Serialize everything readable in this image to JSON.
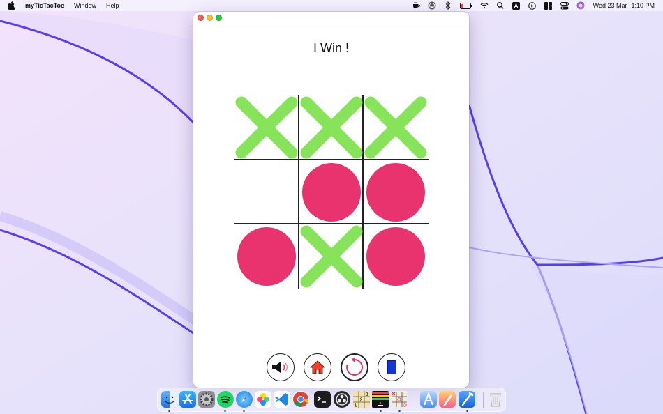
{
  "menubar": {
    "app_name": "myTicTacToe",
    "menus": [
      "Window",
      "Help"
    ],
    "clock_day": "Wed 23 Mar",
    "clock_time": "1:10 PM",
    "status_icons": [
      "coffee-icon",
      "airplay-icon",
      "bluetooth-icon",
      "battery-icon",
      "wifi-icon",
      "spotlight-search-icon",
      "keyboard-input-icon",
      "play-icon",
      "window-layout-icon",
      "control-center-icon",
      "siri-icon"
    ]
  },
  "game": {
    "status_text": "I Win !",
    "board": [
      "X",
      "X",
      "X",
      "",
      "O",
      "O",
      "O",
      "X",
      "O"
    ],
    "colors": {
      "x": "#86e35a",
      "o": "#e8336f",
      "grid": "#222222",
      "home": "#ff3b1f",
      "book": "#1535d6",
      "restart": "#e8336f"
    }
  },
  "controls": {
    "buttons": [
      "sound-icon",
      "home-icon",
      "restart-icon",
      "book-icon"
    ]
  },
  "dock": {
    "apps": [
      "finder-icon",
      "app-store-icon",
      "system-preferences-icon",
      "spotify-icon",
      "safari-icon",
      "photos-icon",
      "vscode-icon",
      "chrome-icon",
      "terminal-icon",
      "obs-icon",
      "sudoku-icon",
      "arkanoid-icon",
      "tictactoe-icon",
      "xcode-instruments-icon",
      "pixelmator-icon",
      "xcode-icon",
      "trash-icon"
    ]
  }
}
